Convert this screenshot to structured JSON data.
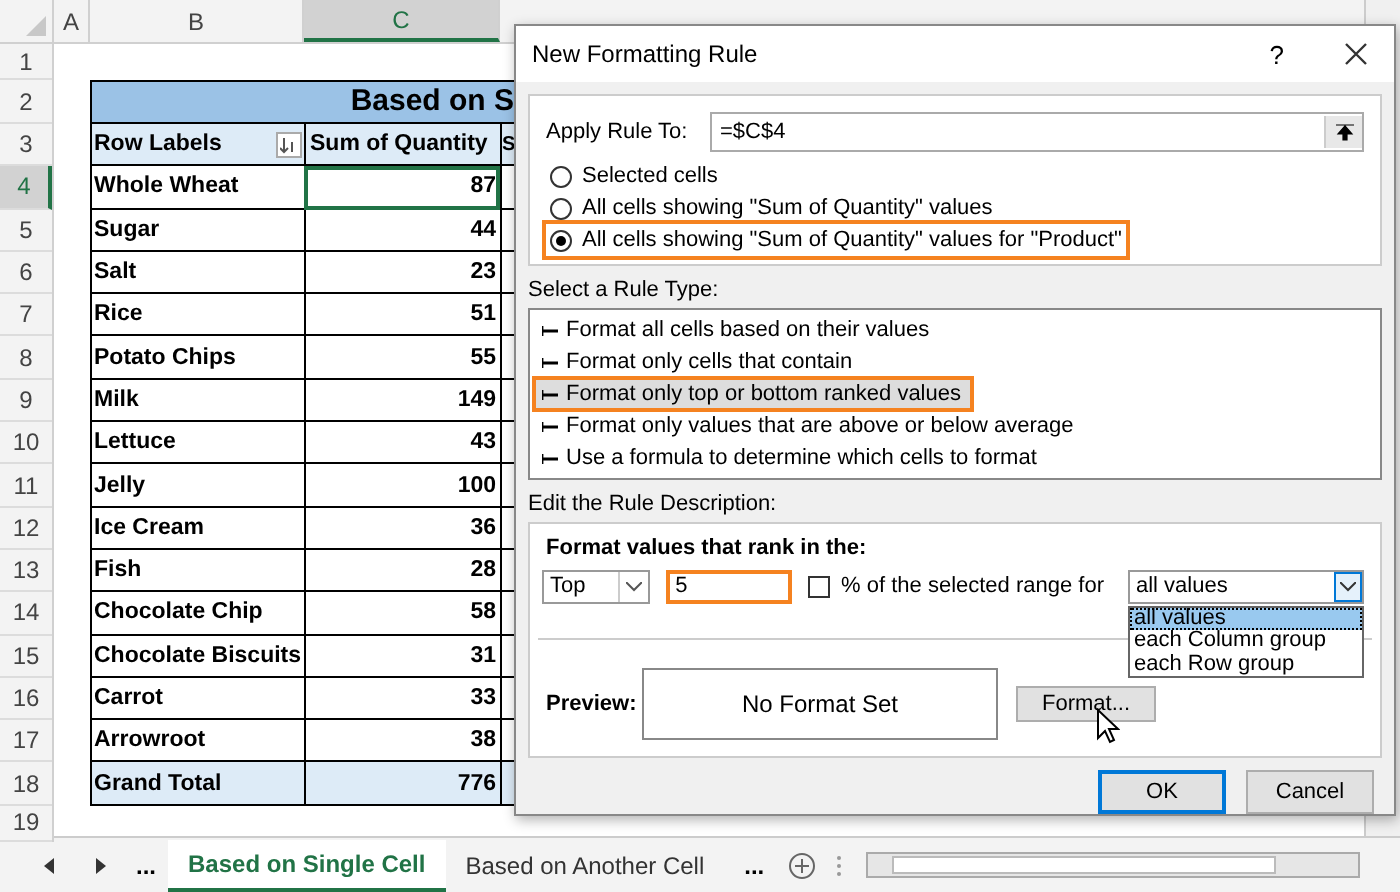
{
  "sheet": {
    "columns": [
      {
        "label": "A",
        "selected": false
      },
      {
        "label": "B",
        "selected": false
      },
      {
        "label": "C",
        "selected": true
      }
    ],
    "row_numbers": [
      {
        "label": "1",
        "selected": false
      },
      {
        "label": "2",
        "selected": false
      },
      {
        "label": "3",
        "selected": false
      },
      {
        "label": "4",
        "selected": true
      },
      {
        "label": "5",
        "selected": false
      },
      {
        "label": "6",
        "selected": false
      },
      {
        "label": "7",
        "selected": false
      },
      {
        "label": "8",
        "selected": false
      },
      {
        "label": "9",
        "selected": false
      },
      {
        "label": "10",
        "selected": false
      },
      {
        "label": "11",
        "selected": false
      },
      {
        "label": "12",
        "selected": false
      },
      {
        "label": "13",
        "selected": false
      },
      {
        "label": "14",
        "selected": false
      },
      {
        "label": "15",
        "selected": false
      },
      {
        "label": "16",
        "selected": false
      },
      {
        "label": "17",
        "selected": false
      },
      {
        "label": "18",
        "selected": false
      },
      {
        "label": "19",
        "selected": false
      }
    ]
  },
  "pivot": {
    "title": "Based on S",
    "headers": [
      "Row Labels",
      "Sum of Quantity",
      "S"
    ],
    "rows": [
      {
        "label": "Whole Wheat",
        "value": "87",
        "selected": true
      },
      {
        "label": "Sugar",
        "value": "44",
        "selected": false
      },
      {
        "label": "Salt",
        "value": "23",
        "selected": false
      },
      {
        "label": "Rice",
        "value": "51",
        "selected": false
      },
      {
        "label": "Potato Chips",
        "value": "55",
        "selected": false
      },
      {
        "label": "Milk",
        "value": "149",
        "selected": false
      },
      {
        "label": "Lettuce",
        "value": "43",
        "selected": false
      },
      {
        "label": "Jelly",
        "value": "100",
        "selected": false
      },
      {
        "label": "Ice Cream",
        "value": "36",
        "selected": false
      },
      {
        "label": "Fish",
        "value": "28",
        "selected": false
      },
      {
        "label": "Chocolate Chip",
        "value": "58",
        "selected": false
      },
      {
        "label": "Chocolate Biscuits",
        "value": "31",
        "selected": false
      },
      {
        "label": "Carrot",
        "value": "33",
        "selected": false
      },
      {
        "label": "Arrowroot",
        "value": "38",
        "selected": false
      }
    ],
    "total": {
      "label": "Grand Total",
      "value": "776"
    }
  },
  "sheet_tabs": {
    "more": "...",
    "tabs": [
      {
        "label": "Based on Single Cell",
        "selected": true
      },
      {
        "label": "Based on Another Cell",
        "selected": false
      }
    ],
    "more_after": "..."
  },
  "dialog": {
    "title": "New Formatting Rule",
    "help": "?",
    "apply_label": "Apply Rule To:",
    "apply_value": "=$C$4",
    "scopes": [
      {
        "label": "Selected cells",
        "selected": false,
        "highlighted": false
      },
      {
        "label": "All cells showing \"Sum of Quantity\" values",
        "selected": false,
        "highlighted": false
      },
      {
        "label": "All cells showing \"Sum of Quantity\" values for \"Product\"",
        "selected": true,
        "highlighted": true
      }
    ],
    "rule_type_label": "Select a Rule Type:",
    "rule_types": [
      {
        "label": "Format all cells based on their values",
        "selected": false,
        "highlighted": false
      },
      {
        "label": "Format only cells that contain",
        "selected": false,
        "highlighted": false
      },
      {
        "label": "Format only top or bottom ranked values",
        "selected": true,
        "highlighted": true
      },
      {
        "label": "Format only values that are above or below average",
        "selected": false,
        "highlighted": false
      },
      {
        "label": "Use a formula to determine which cells to format",
        "selected": false,
        "highlighted": false
      }
    ],
    "description_label": "Edit the Rule Description:",
    "rank_heading": "Format values that rank in the:",
    "rank_direction": "Top",
    "rank_value": {
      "value": "5",
      "highlighted": true
    },
    "percent": {
      "label": "% of the selected range for",
      "checked": false
    },
    "range_for": {
      "value": "all values",
      "expanded": true,
      "options": [
        {
          "label": "all values",
          "selected": true
        },
        {
          "label": "each Column group",
          "selected": false
        },
        {
          "label": "each Row group",
          "selected": false
        }
      ]
    },
    "preview_label": "Preview:",
    "preview_text": "No Format Set",
    "format_button": "Format...",
    "ok": "OK",
    "cancel": "Cancel"
  }
}
